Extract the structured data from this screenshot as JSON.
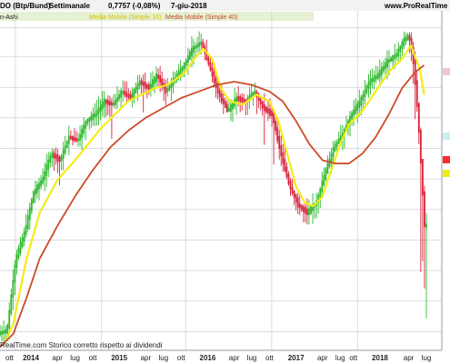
{
  "header": {
    "instrument": "DO (Btp/Bund)",
    "period": "Settimanale",
    "quote": "0,7757 (-0,08%)",
    "date": "7-giu-2018",
    "site": "www.ProRealTime"
  },
  "legend": {
    "candles": "n-Ashi",
    "ma10": "Media Mobile (Simple 10)",
    "ma40": "Media Mobile (Simple 40)"
  },
  "footer": {
    "note": "RealTime.com  Storico corretto rispetto ai dividendi"
  },
  "colors": {
    "bull": "#2db82d",
    "bear": "#d9213a",
    "ma10": "#f4ec16",
    "ma40": "#cc4a28",
    "grid": "#c6c6d2",
    "legend_bg": "#e6f0d2"
  },
  "chart_data": {
    "type": "line",
    "x_labels": [
      "2014",
      "apr",
      "lug",
      "ott",
      "2015",
      "apr",
      "lug",
      "ott",
      "2016",
      "apr",
      "lug",
      "ott",
      "2017",
      "apr",
      "lug",
      "ott",
      "2018",
      "apr",
      "lug"
    ],
    "x_labels_bold": [
      "2014",
      "2015",
      "2016",
      "2017",
      "2018"
    ],
    "x_labels_left_edge": [
      "ott"
    ],
    "candle_style": "Heikin-Ashi",
    "series": [
      {
        "name": "Media Mobile (Simple 10)",
        "color": "#f4ec16",
        "points": [
          [
            0.01,
            0.02
          ],
          [
            0.03,
            0.08
          ],
          [
            0.06,
            0.28
          ],
          [
            0.09,
            0.42
          ],
          [
            0.13,
            0.52
          ],
          [
            0.17,
            0.58
          ],
          [
            0.2,
            0.63
          ],
          [
            0.23,
            0.68
          ],
          [
            0.26,
            0.72
          ],
          [
            0.29,
            0.76
          ],
          [
            0.32,
            0.78
          ],
          [
            0.35,
            0.8
          ],
          [
            0.38,
            0.81
          ],
          [
            0.4,
            0.83
          ],
          [
            0.42,
            0.85
          ],
          [
            0.44,
            0.89
          ],
          [
            0.46,
            0.92
          ],
          [
            0.48,
            0.89
          ],
          [
            0.5,
            0.8
          ],
          [
            0.52,
            0.76
          ],
          [
            0.55,
            0.75
          ],
          [
            0.58,
            0.78
          ],
          [
            0.61,
            0.76
          ],
          [
            0.63,
            0.7
          ],
          [
            0.65,
            0.6
          ],
          [
            0.67,
            0.5
          ],
          [
            0.69,
            0.45
          ],
          [
            0.71,
            0.44
          ],
          [
            0.73,
            0.47
          ],
          [
            0.75,
            0.55
          ],
          [
            0.77,
            0.63
          ],
          [
            0.79,
            0.69
          ],
          [
            0.82,
            0.73
          ],
          [
            0.85,
            0.79
          ],
          [
            0.88,
            0.85
          ],
          [
            0.91,
            0.89
          ],
          [
            0.93,
            0.93
          ],
          [
            0.95,
            0.86
          ],
          [
            0.96,
            0.78
          ]
        ]
      },
      {
        "name": "Media Mobile (Simple 40)",
        "color": "#cc4a28",
        "points": [
          [
            0.0,
            0.01
          ],
          [
            0.03,
            0.05
          ],
          [
            0.06,
            0.16
          ],
          [
            0.09,
            0.28
          ],
          [
            0.13,
            0.38
          ],
          [
            0.17,
            0.47
          ],
          [
            0.21,
            0.55
          ],
          [
            0.25,
            0.62
          ],
          [
            0.29,
            0.67
          ],
          [
            0.33,
            0.71
          ],
          [
            0.37,
            0.74
          ],
          [
            0.41,
            0.77
          ],
          [
            0.45,
            0.79
          ],
          [
            0.49,
            0.81
          ],
          [
            0.53,
            0.82
          ],
          [
            0.57,
            0.81
          ],
          [
            0.61,
            0.79
          ],
          [
            0.64,
            0.76
          ],
          [
            0.67,
            0.7
          ],
          [
            0.7,
            0.63
          ],
          [
            0.73,
            0.58
          ],
          [
            0.76,
            0.57
          ],
          [
            0.79,
            0.57
          ],
          [
            0.82,
            0.6
          ],
          [
            0.85,
            0.65
          ],
          [
            0.88,
            0.72
          ],
          [
            0.91,
            0.8
          ],
          [
            0.94,
            0.85
          ],
          [
            0.96,
            0.87
          ]
        ]
      }
    ],
    "price_path": [
      [
        0.0,
        0.05
      ],
      [
        0.02,
        0.06
      ],
      [
        0.04,
        0.28
      ],
      [
        0.06,
        0.36
      ],
      [
        0.08,
        0.48
      ],
      [
        0.1,
        0.52
      ],
      [
        0.12,
        0.6
      ],
      [
        0.14,
        0.58
      ],
      [
        0.16,
        0.65
      ],
      [
        0.18,
        0.64
      ],
      [
        0.2,
        0.7
      ],
      [
        0.22,
        0.72
      ],
      [
        0.24,
        0.76
      ],
      [
        0.26,
        0.75
      ],
      [
        0.28,
        0.79
      ],
      [
        0.3,
        0.77
      ],
      [
        0.32,
        0.82
      ],
      [
        0.34,
        0.8
      ],
      [
        0.36,
        0.84
      ],
      [
        0.38,
        0.79
      ],
      [
        0.4,
        0.83
      ],
      [
        0.42,
        0.87
      ],
      [
        0.44,
        0.92
      ],
      [
        0.46,
        0.94
      ],
      [
        0.48,
        0.86
      ],
      [
        0.5,
        0.78
      ],
      [
        0.52,
        0.73
      ],
      [
        0.54,
        0.77
      ],
      [
        0.56,
        0.76
      ],
      [
        0.58,
        0.79
      ],
      [
        0.6,
        0.74
      ],
      [
        0.62,
        0.72
      ],
      [
        0.64,
        0.6
      ],
      [
        0.66,
        0.5
      ],
      [
        0.68,
        0.44
      ],
      [
        0.7,
        0.42
      ],
      [
        0.72,
        0.45
      ],
      [
        0.74,
        0.54
      ],
      [
        0.76,
        0.62
      ],
      [
        0.78,
        0.66
      ],
      [
        0.8,
        0.72
      ],
      [
        0.82,
        0.76
      ],
      [
        0.84,
        0.82
      ],
      [
        0.86,
        0.84
      ],
      [
        0.88,
        0.88
      ],
      [
        0.9,
        0.9
      ],
      [
        0.92,
        0.95
      ],
      [
        0.93,
        0.96
      ],
      [
        0.94,
        0.88
      ],
      [
        0.95,
        0.72
      ],
      [
        0.96,
        0.5
      ],
      [
        0.965,
        0.38
      ]
    ]
  }
}
